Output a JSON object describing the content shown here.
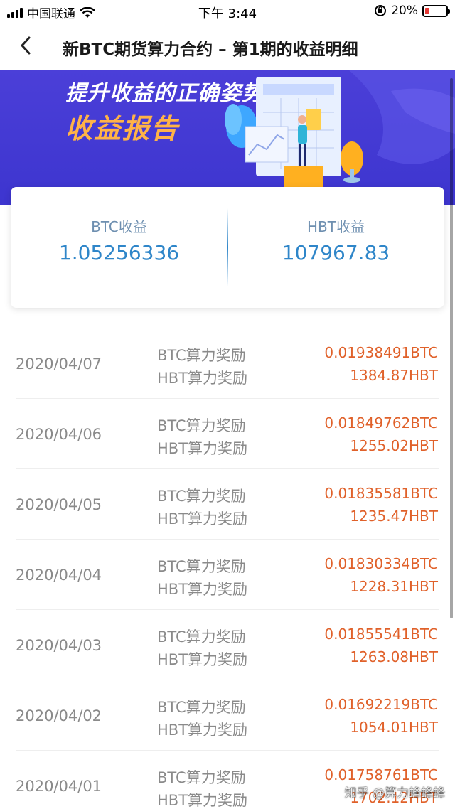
{
  "status_bar": {
    "carrier": "中国联通",
    "time": "下午 3:44",
    "battery": "20%",
    "battery_level": 0.2
  },
  "nav": {
    "title": "新BTC期货算力合约 – 第1期的收益明细"
  },
  "banner": {
    "line1": "提升收益的正确姿势",
    "line2": "收益报告"
  },
  "summary": {
    "btc_label": "BTC收益",
    "btc_value": "1.05256336",
    "hbt_label": "HBT收益",
    "hbt_value": "107967.83"
  },
  "records": [
    {
      "date": "2020/04/07",
      "type1": "BTC算力奖励",
      "type2": "HBT算力奖励",
      "amt1": "0.01938491BTC",
      "amt2": "1384.87HBT"
    },
    {
      "date": "2020/04/06",
      "type1": "BTC算力奖励",
      "type2": "HBT算力奖励",
      "amt1": "0.01849762BTC",
      "amt2": "1255.02HBT"
    },
    {
      "date": "2020/04/05",
      "type1": "BTC算力奖励",
      "type2": "HBT算力奖励",
      "amt1": "0.01835581BTC",
      "amt2": "1235.47HBT"
    },
    {
      "date": "2020/04/04",
      "type1": "BTC算力奖励",
      "type2": "HBT算力奖励",
      "amt1": "0.01830334BTC",
      "amt2": "1228.31HBT"
    },
    {
      "date": "2020/04/03",
      "type1": "BTC算力奖励",
      "type2": "HBT算力奖励",
      "amt1": "0.01855541BTC",
      "amt2": "1263.08HBT"
    },
    {
      "date": "2020/04/02",
      "type1": "BTC算力奖励",
      "type2": "HBT算力奖励",
      "amt1": "0.01692219BTC",
      "amt2": "1054.01HBT"
    },
    {
      "date": "2020/04/01",
      "type1": "BTC算力奖励",
      "type2": "HBT算力奖励",
      "amt1": "0.01758761BTC",
      "amt2": "1702.12HBT"
    }
  ],
  "watermark": "知乎 @算力蜂蜂蜂",
  "colors": {
    "banner": "#4b3fd8",
    "accent_blue": "#2f86c9",
    "amount_orange": "#e0612a",
    "banner_highlight": "#ffb347"
  },
  "icons": {
    "back": "chevron-left-icon",
    "wifi": "wifi-icon",
    "signal": "signal-icon",
    "battery": "battery-icon",
    "rotation_lock": "rotation-lock-icon"
  }
}
